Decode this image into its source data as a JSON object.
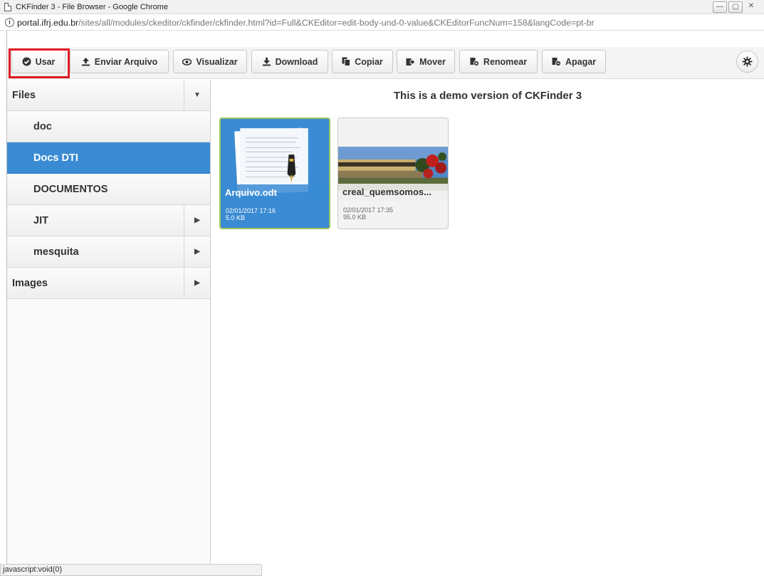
{
  "window": {
    "title": "CKFinder 3 - File Browser - Google Chrome",
    "minimize": "—",
    "maximize": "▢",
    "close": "✕"
  },
  "address": {
    "host": "portal.ifrj.edu.br",
    "path": "/sites/all/modules/ckeditor/ckfinder/ckfinder.html?id=Full&CKEditor=edit-body-und-0-value&CKEditorFuncNum=158&langCode=pt-br"
  },
  "toolbar": {
    "usar": "Usar",
    "enviar": "Enviar Arquivo",
    "visualizar": "Visualizar",
    "download": "Download",
    "copiar": "Copiar",
    "mover": "Mover",
    "renomear": "Renomear",
    "apagar": "Apagar"
  },
  "sidebar": {
    "files": "Files",
    "doc": "doc",
    "docs_dti": "Docs DTI",
    "documentos": "DOCUMENTOS",
    "jit": "JIT",
    "mesquita": "mesquita",
    "images": "Images"
  },
  "main": {
    "banner": "This is a demo version of CKFinder 3",
    "files": [
      {
        "name": "Arquivo.odt",
        "date": "02/01/2017 17:16",
        "size": "5.0 KB"
      },
      {
        "name": "creal_quemsomos...",
        "date": "02/01/2017 17:35",
        "size": "95.0 KB"
      }
    ]
  },
  "status": "javascript:void(0)",
  "colors": {
    "accent": "#3a8bd3",
    "highlight": "#e01b24",
    "selection_border": "#9cc45e"
  }
}
